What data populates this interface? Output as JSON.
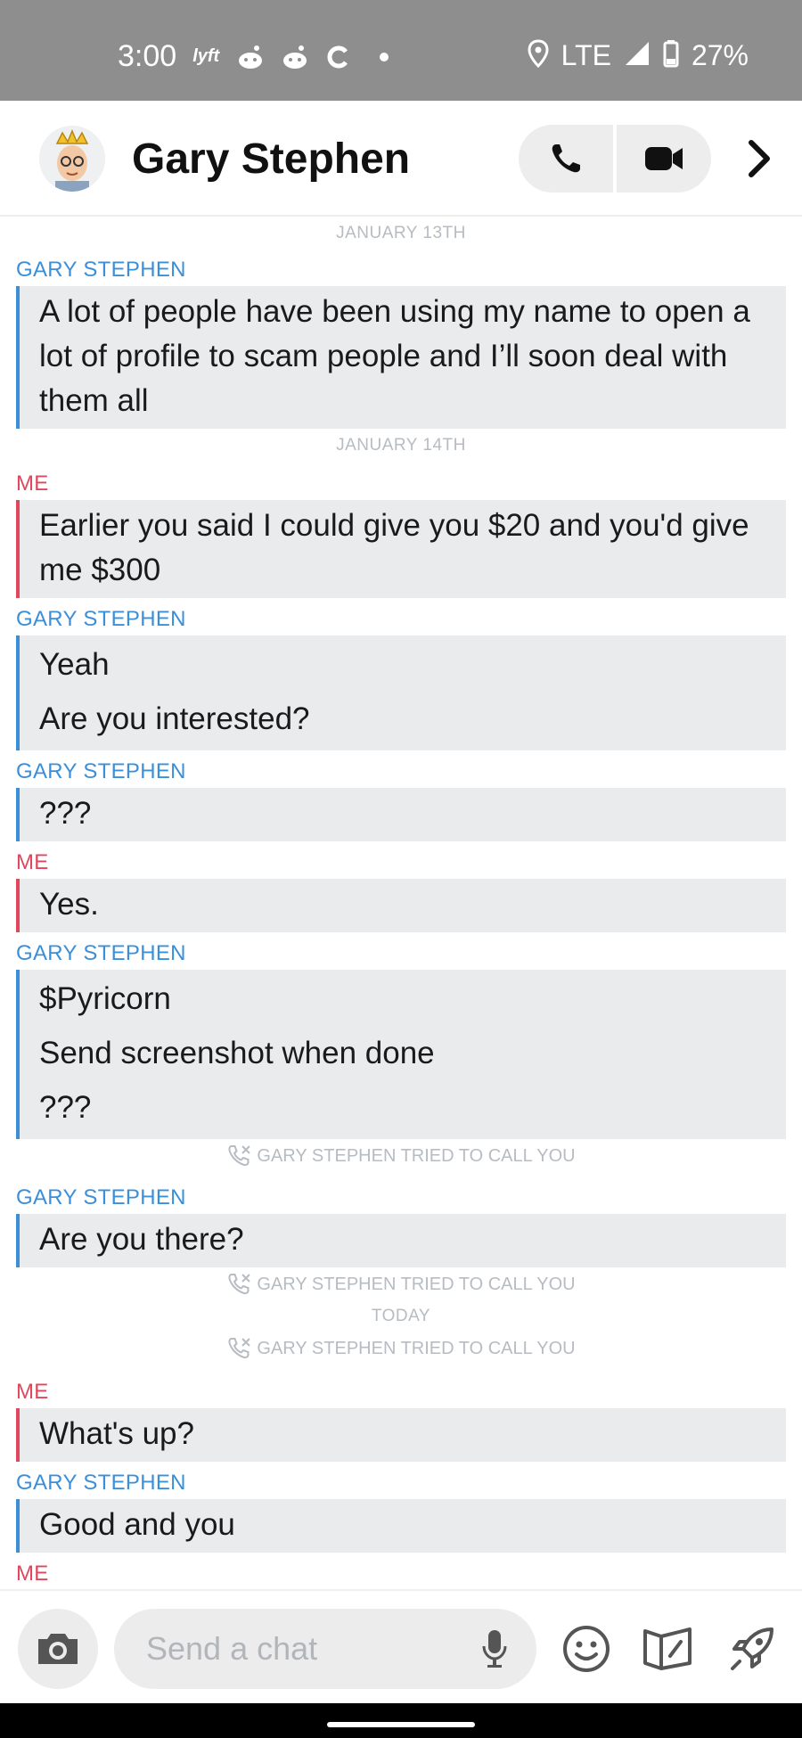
{
  "status_bar": {
    "time": "3:00",
    "left_icons": [
      "lyft-icon",
      "reddit-icon",
      "reddit-icon",
      "circle-c-icon",
      "dot-icon"
    ],
    "network": "LTE",
    "battery": "27%"
  },
  "header": {
    "contact_name": "Gary Stephen",
    "avatar_icon": "bitmoji-avatar-icon"
  },
  "chat": {
    "date_1": "JANUARY 13TH",
    "sender_1": "GARY STEPHEN",
    "msg_1": "A lot of people have been using my name to open a lot of profile to scam people and I’ll soon deal with them all",
    "date_2": "JANUARY 14TH",
    "sender_2": "ME",
    "msg_2": "Earlier you said I could give you $20 and you'd give me $300",
    "sender_3": "GARY STEPHEN",
    "msg_3a": "Yeah",
    "msg_3b": "Are you interested?",
    "sender_4": "GARY STEPHEN",
    "msg_4": "???",
    "sender_5": "ME",
    "msg_5": "Yes.",
    "sender_6": "GARY STEPHEN",
    "msg_6a": "$Pyricorn",
    "msg_6b": "Send screenshot when done",
    "msg_6c": "???",
    "call_1": "GARY STEPHEN TRIED TO CALL YOU",
    "sender_7": "GARY STEPHEN",
    "msg_7": "Are you there?",
    "call_2": "GARY STEPHEN TRIED TO CALL YOU",
    "date_3": "TODAY",
    "call_3": "GARY STEPHEN TRIED TO CALL YOU",
    "sender_8": "ME",
    "msg_8": "What's up?",
    "sender_9": "GARY STEPHEN",
    "msg_9": "Good and you",
    "sender_10": "ME"
  },
  "composer": {
    "placeholder": "Send a chat"
  },
  "colors": {
    "them": "#3b8fd9",
    "me": "#e0475d",
    "bubble_bg": "#eaebed",
    "status_bar_bg": "#8e8e8e"
  }
}
